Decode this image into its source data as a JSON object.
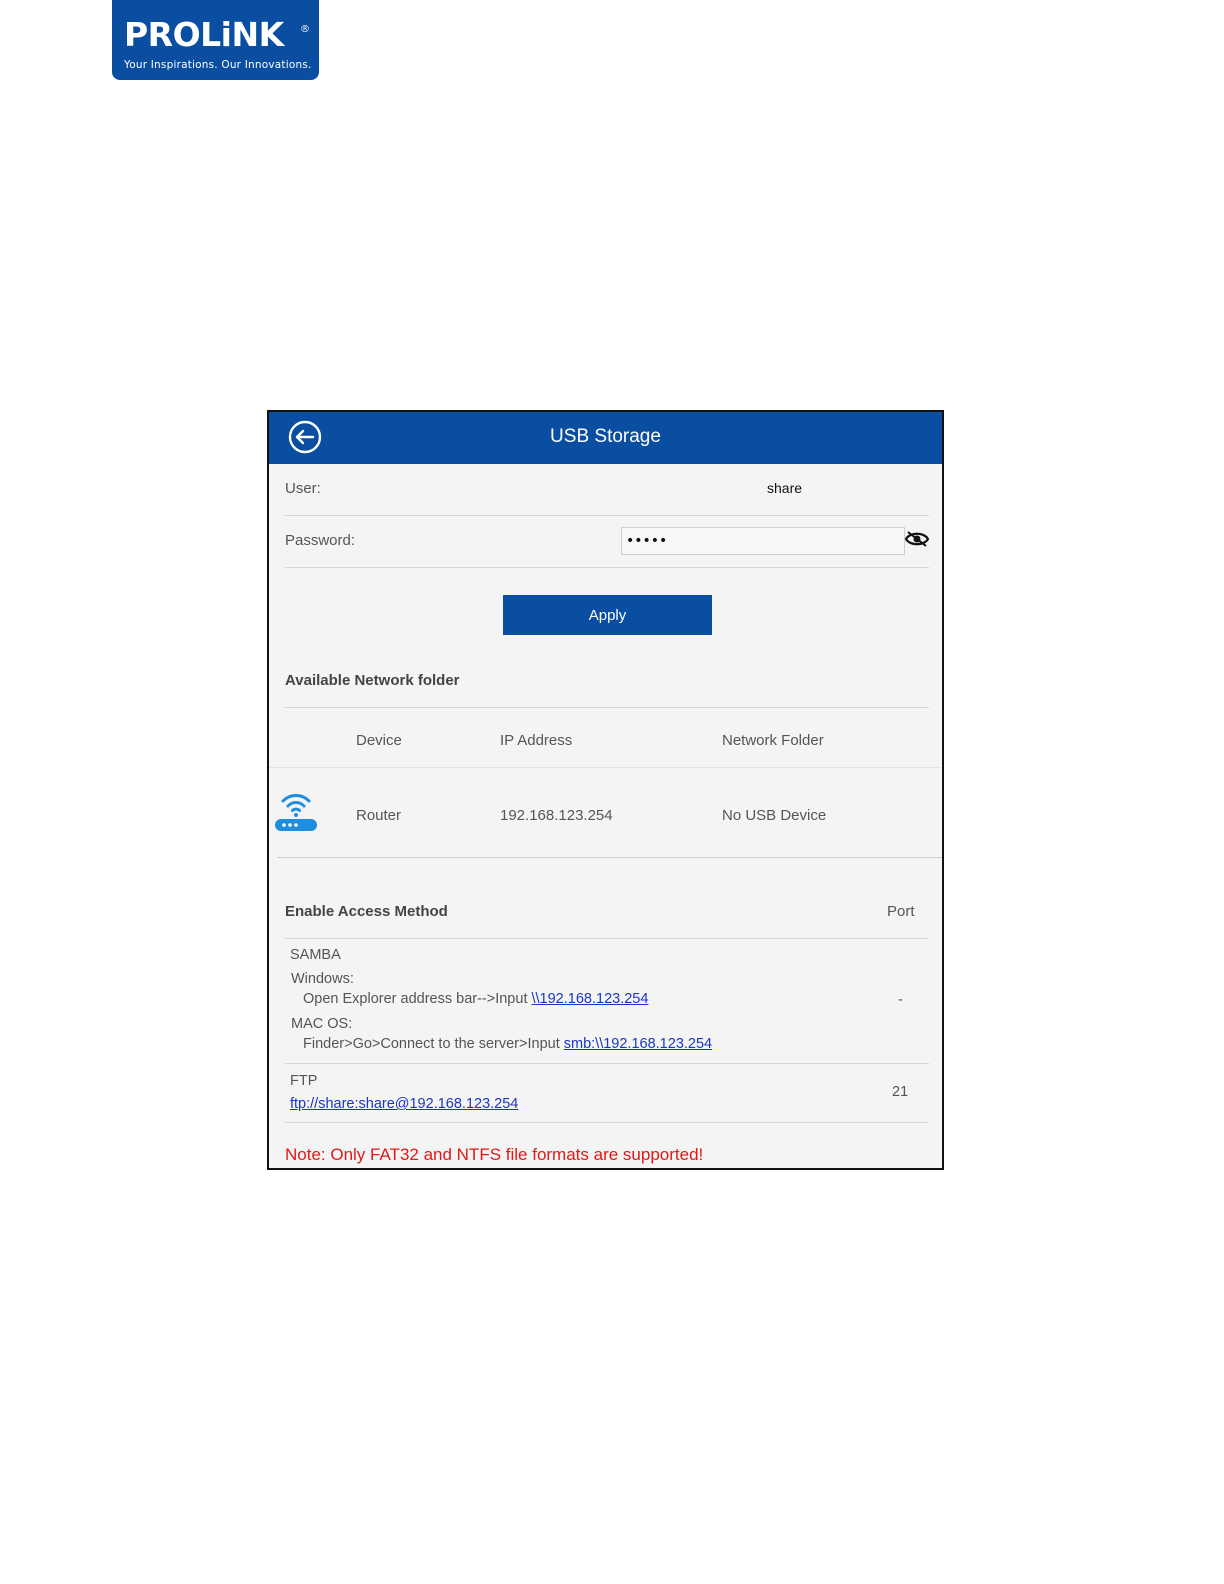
{
  "logo": {
    "brand": "PROLiNK",
    "registered": "®",
    "tagline": "Your Inspirations. Our Innovations."
  },
  "header": {
    "title": "USB Storage",
    "back_icon": "arrow-left-circle-icon"
  },
  "form": {
    "user_label": "User:",
    "user_value": "share",
    "password_label": "Password:",
    "password_value": "•••••",
    "eye_icon": "eye-hidden-icon",
    "apply_label": "Apply"
  },
  "network_folder": {
    "section_title": "Available Network folder",
    "columns": [
      "Device",
      "IP Address",
      "Network Folder"
    ],
    "rows": [
      {
        "icon": "wifi-router-icon",
        "device": "Router",
        "ip": "192.168.123.254",
        "folder": "No USB Device"
      }
    ]
  },
  "access": {
    "section_title": "Enable Access Method",
    "port_header": "Port",
    "samba": {
      "name": "SAMBA",
      "windows_label": "Windows:",
      "windows_text": "Open Explorer address bar-->Input ",
      "windows_link": "\\\\192.168.123.254",
      "mac_label": "MAC OS:",
      "mac_text": "Finder>Go>Connect to the server>Input ",
      "mac_link": "smb:\\\\192.168.123.254",
      "port": "-"
    },
    "ftp": {
      "name": "FTP",
      "link": "ftp://share:share@192.168.123.254",
      "port": "21"
    }
  },
  "note": "Note: Only FAT32 and NTFS file formats are supported!",
  "colors": {
    "brand_blue": "#0a4ea2",
    "note_red": "#e01919",
    "link_blue": "#1a35c8",
    "panel_bg": "#f4f4f4"
  }
}
